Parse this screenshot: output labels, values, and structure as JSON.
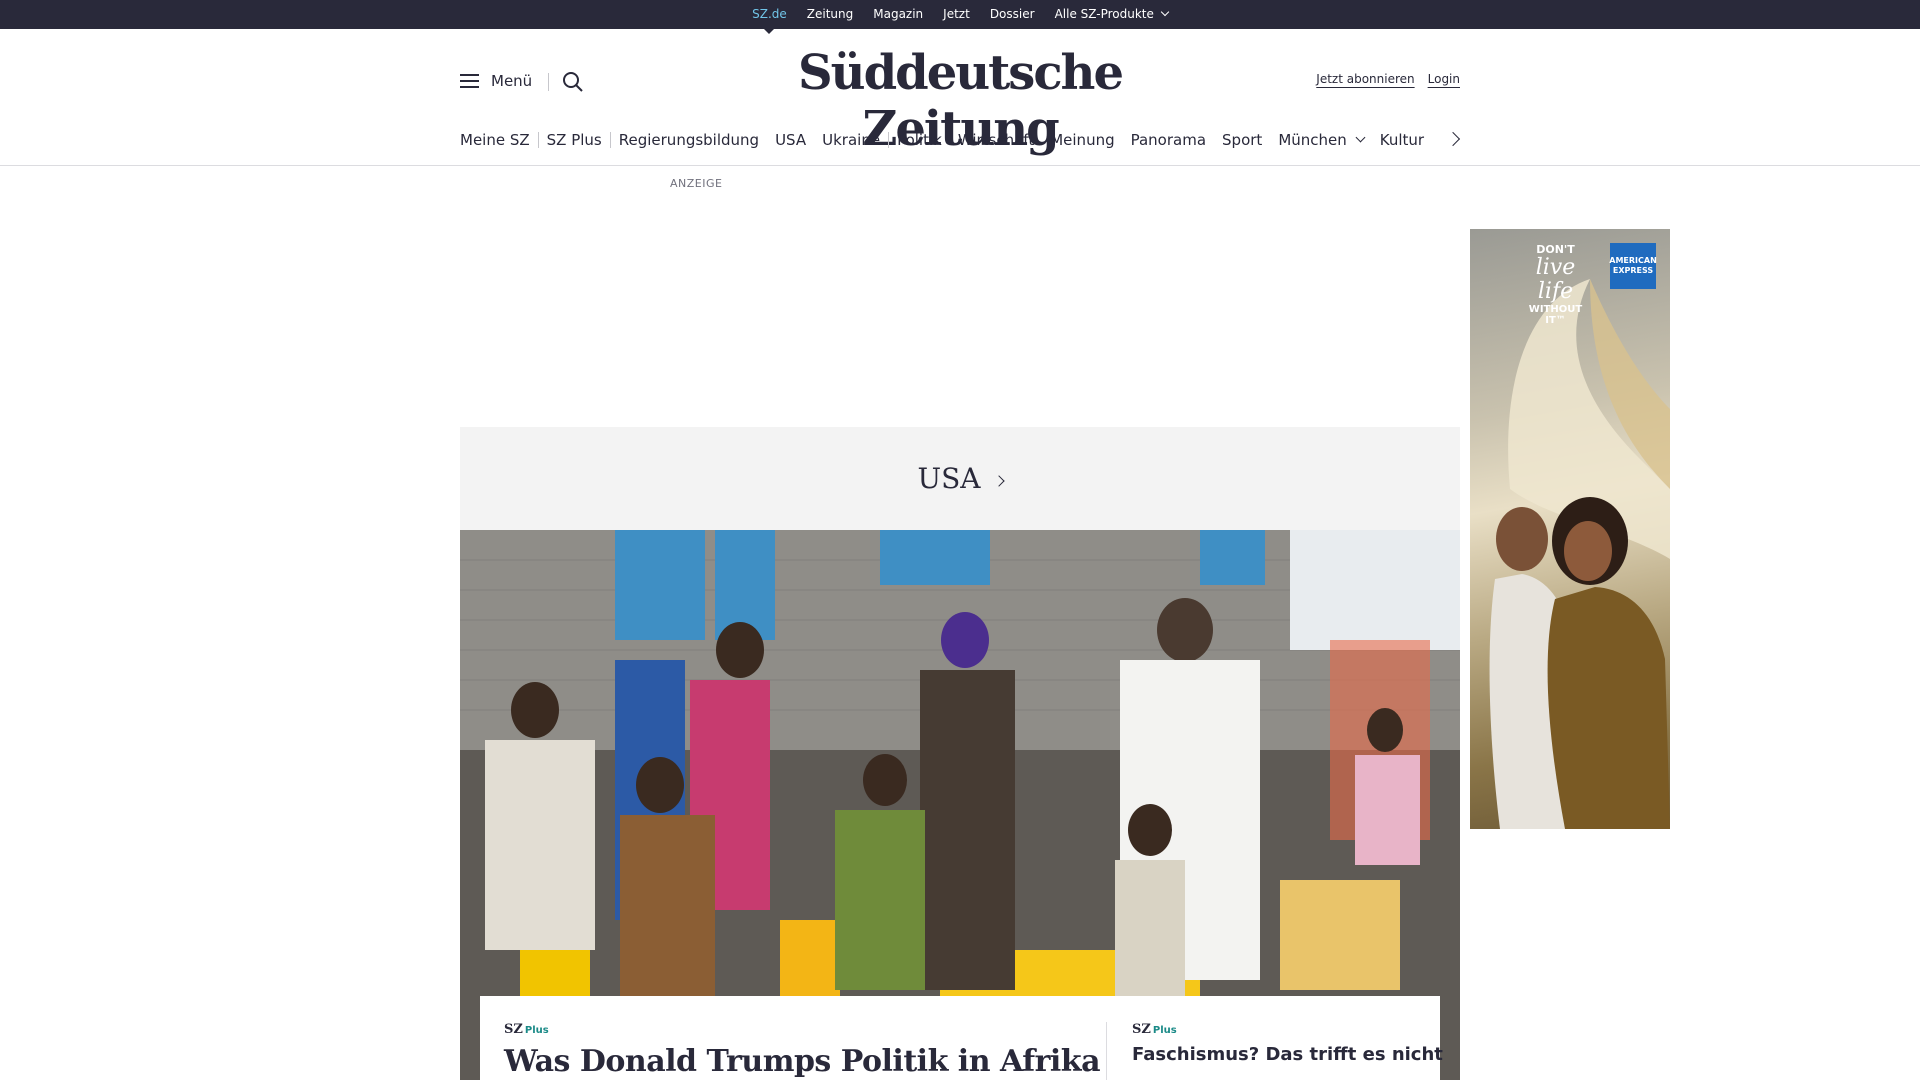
{
  "topbar": {
    "items": [
      "SZ.de",
      "Zeitung",
      "Magazin",
      "Jetzt",
      "Dossier",
      "Alle SZ-Produkte"
    ]
  },
  "header": {
    "menu_label": "Menü",
    "logo": "Süddeutsche Zeitung",
    "subscribe_label": "Jetzt abonnieren",
    "login_label": "Login"
  },
  "nav": {
    "items": [
      "Meine SZ",
      "SZ Plus",
      "Regierungsbildung",
      "USA",
      "Ukraine",
      "Politik",
      "Wirtschaft",
      "Meinung",
      "Panorama",
      "Sport",
      "München",
      "Kultur"
    ]
  },
  "ad": {
    "label": "ANZEIGE",
    "side_dont": "DON'T",
    "side_live": "live life",
    "side_without": "WITHOUT IT™",
    "side_brand_line1": "AMERICAN",
    "side_brand_line2": "EXPRESS"
  },
  "section": {
    "title": "USA"
  },
  "teasers": [
    {
      "brand": "SZ",
      "badge": "Plus",
      "title": "Was Donald Trumps Politik in Afrika"
    },
    {
      "brand": "SZ",
      "badge": "Plus",
      "title": "Faschismus? Das trifft es nicht"
    }
  ],
  "colors": {
    "topbar_bg": "#29293a",
    "topbar_active": "#71c5e8",
    "plus_accent": "#1a8a87",
    "section_bg": "#f3f3f3"
  }
}
